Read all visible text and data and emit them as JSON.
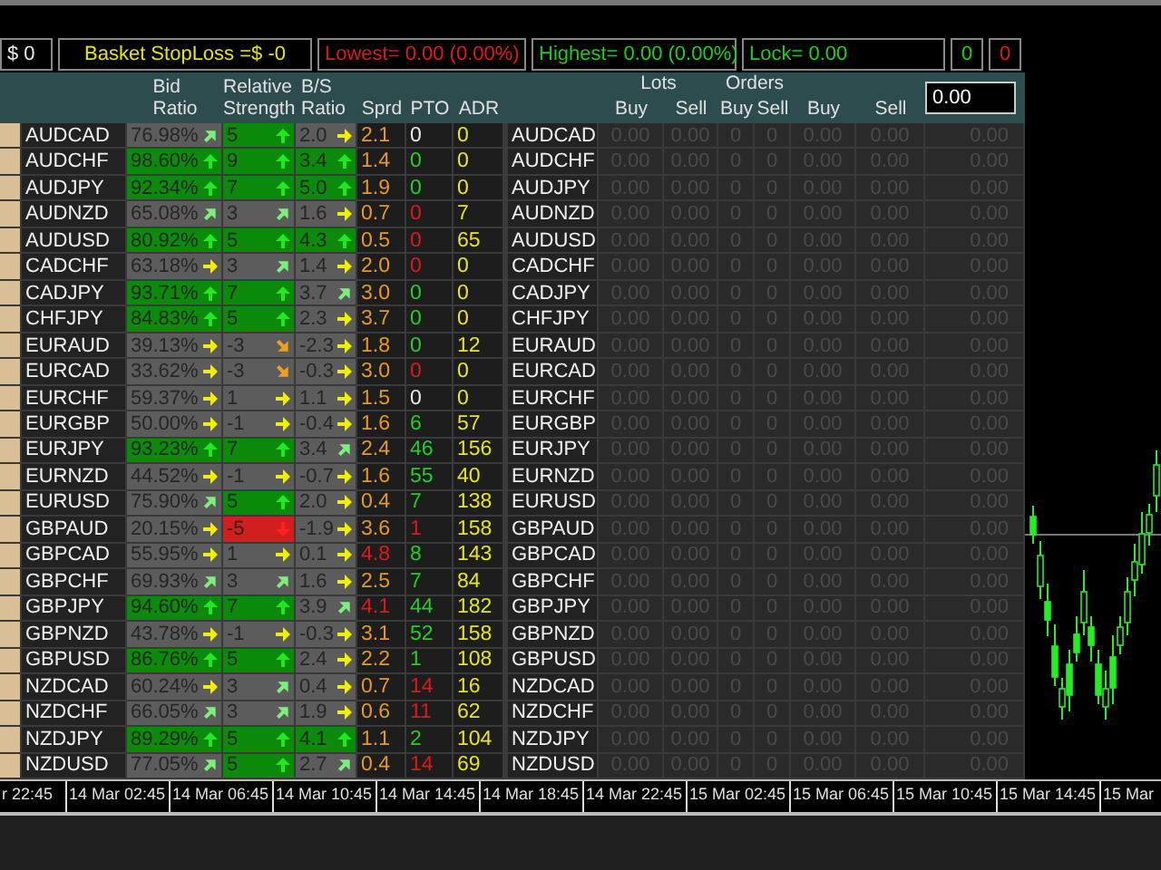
{
  "info_bar": [
    {
      "text": "$ 0",
      "color": "#e8e8e8"
    },
    {
      "text": "Basket StopLoss =$ -0",
      "color": "#e6e600"
    },
    {
      "text": "Lowest= 0.00 (0.00%)",
      "color": "#e01818"
    },
    {
      "text": "Highest= 0.00 (0.00%)",
      "color": "#18d018"
    },
    {
      "text": "Lock= 0.00",
      "color": "#18d018"
    },
    {
      "text": "0",
      "color": "#18d018"
    },
    {
      "text": "0",
      "color": "#e01818"
    }
  ],
  "header": {
    "bid_ratio": "Bid Ratio",
    "relative_strength": "Relative Strength",
    "bs_ratio": "B/S Ratio",
    "sprd": "Sprd",
    "pto": "PTO",
    "adr": "ADR",
    "lots": "Lots",
    "lots_buy": "Buy",
    "lots_sell": "Sell",
    "orders": "Orders",
    "orders_buy": "Buy",
    "orders_sell": "Sell",
    "profit_buy": "Buy",
    "profit_sell": "Sell",
    "total_field": "0.00"
  },
  "rows": [
    {
      "symbol": "AUDCAD",
      "bid": {
        "text": "76.98%",
        "kind": "up-right",
        "color": "#5c5c5c"
      },
      "rs": {
        "text": "5",
        "kind": "up",
        "color": "#0c8a0c"
      },
      "bs": {
        "text": "2.0",
        "kind": "right",
        "color": "#5c5c5c"
      },
      "sprd": {
        "text": "2.1",
        "color": "#e89a20"
      },
      "pto": {
        "text": "0",
        "color": "#e8e8e8"
      },
      "adr": "0",
      "symbol_2": "AUDCAD",
      "positions": [
        "0.00",
        "0.00",
        "0",
        "0",
        "0.00",
        "0.00",
        "0.00"
      ]
    },
    {
      "symbol": "AUDCHF",
      "bid": {
        "text": "98.60%",
        "kind": "up",
        "color": "#0c8a0c"
      },
      "rs": {
        "text": "9",
        "kind": "up",
        "color": "#0c8a0c"
      },
      "bs": {
        "text": "3.4",
        "kind": "up",
        "color": "#0c8a0c"
      },
      "sprd": {
        "text": "1.4",
        "color": "#e89a20"
      },
      "pto": {
        "text": "0",
        "color": "#22d022"
      },
      "adr": "0",
      "symbol_2": "AUDCHF",
      "positions": [
        "0.00",
        "0.00",
        "0",
        "0",
        "0.00",
        "0.00",
        "0.00"
      ]
    },
    {
      "symbol": "AUDJPY",
      "bid": {
        "text": "92.34%",
        "kind": "up",
        "color": "#0c8a0c"
      },
      "rs": {
        "text": "7",
        "kind": "up",
        "color": "#0c8a0c"
      },
      "bs": {
        "text": "5.0",
        "kind": "up",
        "color": "#0c8a0c"
      },
      "sprd": {
        "text": "1.9",
        "color": "#e89a20"
      },
      "pto": {
        "text": "0",
        "color": "#22d022"
      },
      "adr": "0",
      "symbol_2": "AUDJPY",
      "positions": [
        "0.00",
        "0.00",
        "0",
        "0",
        "0.00",
        "0.00",
        "0.00"
      ]
    },
    {
      "symbol": "AUDNZD",
      "bid": {
        "text": "65.08%",
        "kind": "up-right",
        "color": "#5c5c5c"
      },
      "rs": {
        "text": "3",
        "kind": "up-right",
        "color": "#5c5c5c"
      },
      "bs": {
        "text": "1.6",
        "kind": "right",
        "color": "#5c5c5c"
      },
      "sprd": {
        "text": "0.7",
        "color": "#e89a20"
      },
      "pto": {
        "text": "0",
        "color": "#e01818"
      },
      "adr": "7",
      "symbol_2": "AUDNZD",
      "positions": [
        "0.00",
        "0.00",
        "0",
        "0",
        "0.00",
        "0.00",
        "0.00"
      ]
    },
    {
      "symbol": "AUDUSD",
      "bid": {
        "text": "80.92%",
        "kind": "up",
        "color": "#0c8a0c"
      },
      "rs": {
        "text": "5",
        "kind": "up",
        "color": "#0c8a0c"
      },
      "bs": {
        "text": "4.3",
        "kind": "up",
        "color": "#0c8a0c"
      },
      "sprd": {
        "text": "0.5",
        "color": "#e89a20"
      },
      "pto": {
        "text": "0",
        "color": "#e01818"
      },
      "adr": "65",
      "symbol_2": "AUDUSD",
      "positions": [
        "0.00",
        "0.00",
        "0",
        "0",
        "0.00",
        "0.00",
        "0.00"
      ]
    },
    {
      "symbol": "CADCHF",
      "bid": {
        "text": "63.18%",
        "kind": "right",
        "color": "#5c5c5c"
      },
      "rs": {
        "text": "3",
        "kind": "up-right",
        "color": "#5c5c5c"
      },
      "bs": {
        "text": "1.4",
        "kind": "right",
        "color": "#5c5c5c"
      },
      "sprd": {
        "text": "2.0",
        "color": "#e89a20"
      },
      "pto": {
        "text": "0",
        "color": "#e01818"
      },
      "adr": "0",
      "symbol_2": "CADCHF",
      "positions": [
        "0.00",
        "0.00",
        "0",
        "0",
        "0.00",
        "0.00",
        "0.00"
      ]
    },
    {
      "symbol": "CADJPY",
      "bid": {
        "text": "93.71%",
        "kind": "up",
        "color": "#0c8a0c"
      },
      "rs": {
        "text": "7",
        "kind": "up",
        "color": "#0c8a0c"
      },
      "bs": {
        "text": "3.7",
        "kind": "up-right",
        "color": "#5c5c5c"
      },
      "sprd": {
        "text": "3.0",
        "color": "#e89a20"
      },
      "pto": {
        "text": "0",
        "color": "#22d022"
      },
      "adr": "0",
      "symbol_2": "CADJPY",
      "positions": [
        "0.00",
        "0.00",
        "0",
        "0",
        "0.00",
        "0.00",
        "0.00"
      ]
    },
    {
      "symbol": "CHFJPY",
      "bid": {
        "text": "84.83%",
        "kind": "up",
        "color": "#0c8a0c"
      },
      "rs": {
        "text": "5",
        "kind": "up",
        "color": "#0c8a0c"
      },
      "bs": {
        "text": "2.3",
        "kind": "right",
        "color": "#5c5c5c"
      },
      "sprd": {
        "text": "3.7",
        "color": "#e89a20"
      },
      "pto": {
        "text": "0",
        "color": "#22d022"
      },
      "adr": "0",
      "symbol_2": "CHFJPY",
      "positions": [
        "0.00",
        "0.00",
        "0",
        "0",
        "0.00",
        "0.00",
        "0.00"
      ]
    },
    {
      "symbol": "EURAUD",
      "bid": {
        "text": "39.13%",
        "kind": "right",
        "color": "#5c5c5c"
      },
      "rs": {
        "text": "-3",
        "kind": "down-right",
        "color": "#5c5c5c"
      },
      "bs": {
        "text": "-2.3",
        "kind": "right",
        "color": "#5c5c5c"
      },
      "sprd": {
        "text": "1.8",
        "color": "#e89a20"
      },
      "pto": {
        "text": "0",
        "color": "#22d022"
      },
      "adr": "12",
      "symbol_2": "EURAUD",
      "positions": [
        "0.00",
        "0.00",
        "0",
        "0",
        "0.00",
        "0.00",
        "0.00"
      ]
    },
    {
      "symbol": "EURCAD",
      "bid": {
        "text": "33.62%",
        "kind": "right",
        "color": "#5c5c5c"
      },
      "rs": {
        "text": "-3",
        "kind": "down-right",
        "color": "#5c5c5c"
      },
      "bs": {
        "text": "-0.3",
        "kind": "right",
        "color": "#5c5c5c"
      },
      "sprd": {
        "text": "3.0",
        "color": "#e89a20"
      },
      "pto": {
        "text": "0",
        "color": "#e01818"
      },
      "adr": "0",
      "symbol_2": "EURCAD",
      "positions": [
        "0.00",
        "0.00",
        "0",
        "0",
        "0.00",
        "0.00",
        "0.00"
      ]
    },
    {
      "symbol": "EURCHF",
      "bid": {
        "text": "59.37%",
        "kind": "right",
        "color": "#5c5c5c"
      },
      "rs": {
        "text": "1",
        "kind": "right",
        "color": "#5c5c5c"
      },
      "bs": {
        "text": "1.1",
        "kind": "right",
        "color": "#5c5c5c"
      },
      "sprd": {
        "text": "1.5",
        "color": "#e89a20"
      },
      "pto": {
        "text": "0",
        "color": "#e8e8e8"
      },
      "adr": "0",
      "symbol_2": "EURCHF",
      "positions": [
        "0.00",
        "0.00",
        "0",
        "0",
        "0.00",
        "0.00",
        "0.00"
      ]
    },
    {
      "symbol": "EURGBP",
      "bid": {
        "text": "50.00%",
        "kind": "right",
        "color": "#5c5c5c"
      },
      "rs": {
        "text": "-1",
        "kind": "right",
        "color": "#5c5c5c"
      },
      "bs": {
        "text": "-0.4",
        "kind": "right",
        "color": "#5c5c5c"
      },
      "sprd": {
        "text": "1.6",
        "color": "#e89a20"
      },
      "pto": {
        "text": "6",
        "color": "#22d022"
      },
      "adr": "57",
      "symbol_2": "EURGBP",
      "positions": [
        "0.00",
        "0.00",
        "0",
        "0",
        "0.00",
        "0.00",
        "0.00"
      ]
    },
    {
      "symbol": "EURJPY",
      "bid": {
        "text": "93.23%",
        "kind": "up",
        "color": "#0c8a0c"
      },
      "rs": {
        "text": "7",
        "kind": "up",
        "color": "#0c8a0c"
      },
      "bs": {
        "text": "3.4",
        "kind": "up-right",
        "color": "#5c5c5c"
      },
      "sprd": {
        "text": "2.4",
        "color": "#e89a20"
      },
      "pto": {
        "text": "46",
        "color": "#22d022"
      },
      "adr": "156",
      "symbol_2": "EURJPY",
      "positions": [
        "0.00",
        "0.00",
        "0",
        "0",
        "0.00",
        "0.00",
        "0.00"
      ]
    },
    {
      "symbol": "EURNZD",
      "bid": {
        "text": "44.52%",
        "kind": "right",
        "color": "#5c5c5c"
      },
      "rs": {
        "text": "-1",
        "kind": "right",
        "color": "#5c5c5c"
      },
      "bs": {
        "text": "-0.7",
        "kind": "right",
        "color": "#5c5c5c"
      },
      "sprd": {
        "text": "1.6",
        "color": "#e89a20"
      },
      "pto": {
        "text": "55",
        "color": "#22d022"
      },
      "adr": "40",
      "symbol_2": "EURNZD",
      "positions": [
        "0.00",
        "0.00",
        "0",
        "0",
        "0.00",
        "0.00",
        "0.00"
      ]
    },
    {
      "symbol": "EURUSD",
      "bid": {
        "text": "75.90%",
        "kind": "up-right",
        "color": "#5c5c5c"
      },
      "rs": {
        "text": "5",
        "kind": "up",
        "color": "#0c8a0c"
      },
      "bs": {
        "text": "2.0",
        "kind": "right",
        "color": "#5c5c5c"
      },
      "sprd": {
        "text": "0.4",
        "color": "#e89a20"
      },
      "pto": {
        "text": "7",
        "color": "#22d022"
      },
      "adr": "138",
      "symbol_2": "EURUSD",
      "positions": [
        "0.00",
        "0.00",
        "0",
        "0",
        "0.00",
        "0.00",
        "0.00"
      ]
    },
    {
      "symbol": "GBPAUD",
      "bid": {
        "text": "20.15%",
        "kind": "right",
        "color": "#5c5c5c"
      },
      "rs": {
        "text": "-5",
        "kind": "down",
        "color": "#d21e1e"
      },
      "bs": {
        "text": "-1.9",
        "kind": "right",
        "color": "#5c5c5c"
      },
      "sprd": {
        "text": "3.6",
        "color": "#e89a20"
      },
      "pto": {
        "text": "1",
        "color": "#e01818"
      },
      "adr": "158",
      "symbol_2": "GBPAUD",
      "positions": [
        "0.00",
        "0.00",
        "0",
        "0",
        "0.00",
        "0.00",
        "0.00"
      ]
    },
    {
      "symbol": "GBPCAD",
      "bid": {
        "text": "55.95%",
        "kind": "right",
        "color": "#5c5c5c"
      },
      "rs": {
        "text": "1",
        "kind": "right",
        "color": "#5c5c5c"
      },
      "bs": {
        "text": "0.1",
        "kind": "right",
        "color": "#5c5c5c"
      },
      "sprd": {
        "text": "4.8",
        "color": "#e01818"
      },
      "pto": {
        "text": "8",
        "color": "#22d022"
      },
      "adr": "143",
      "symbol_2": "GBPCAD",
      "positions": [
        "0.00",
        "0.00",
        "0",
        "0",
        "0.00",
        "0.00",
        "0.00"
      ]
    },
    {
      "symbol": "GBPCHF",
      "bid": {
        "text": "69.93%",
        "kind": "up-right",
        "color": "#5c5c5c"
      },
      "rs": {
        "text": "3",
        "kind": "up-right",
        "color": "#5c5c5c"
      },
      "bs": {
        "text": "1.6",
        "kind": "right",
        "color": "#5c5c5c"
      },
      "sprd": {
        "text": "2.5",
        "color": "#e89a20"
      },
      "pto": {
        "text": "7",
        "color": "#22d022"
      },
      "adr": "84",
      "symbol_2": "GBPCHF",
      "positions": [
        "0.00",
        "0.00",
        "0",
        "0",
        "0.00",
        "0.00",
        "0.00"
      ]
    },
    {
      "symbol": "GBPJPY",
      "bid": {
        "text": "94.60%",
        "kind": "up",
        "color": "#0c8a0c"
      },
      "rs": {
        "text": "7",
        "kind": "up",
        "color": "#0c8a0c"
      },
      "bs": {
        "text": "3.9",
        "kind": "up-right",
        "color": "#5c5c5c"
      },
      "sprd": {
        "text": "4.1",
        "color": "#e01818"
      },
      "pto": {
        "text": "44",
        "color": "#22d022"
      },
      "adr": "182",
      "symbol_2": "GBPJPY",
      "positions": [
        "0.00",
        "0.00",
        "0",
        "0",
        "0.00",
        "0.00",
        "0.00"
      ]
    },
    {
      "symbol": "GBPNZD",
      "bid": {
        "text": "43.78%",
        "kind": "right",
        "color": "#5c5c5c"
      },
      "rs": {
        "text": "-1",
        "kind": "right",
        "color": "#5c5c5c"
      },
      "bs": {
        "text": "-0.3",
        "kind": "right",
        "color": "#5c5c5c"
      },
      "sprd": {
        "text": "3.1",
        "color": "#e89a20"
      },
      "pto": {
        "text": "52",
        "color": "#22d022"
      },
      "adr": "158",
      "symbol_2": "GBPNZD",
      "positions": [
        "0.00",
        "0.00",
        "0",
        "0",
        "0.00",
        "0.00",
        "0.00"
      ]
    },
    {
      "symbol": "GBPUSD",
      "bid": {
        "text": "86.76%",
        "kind": "up",
        "color": "#0c8a0c"
      },
      "rs": {
        "text": "5",
        "kind": "up",
        "color": "#0c8a0c"
      },
      "bs": {
        "text": "2.4",
        "kind": "right",
        "color": "#5c5c5c"
      },
      "sprd": {
        "text": "2.2",
        "color": "#e89a20"
      },
      "pto": {
        "text": "1",
        "color": "#22d022"
      },
      "adr": "108",
      "symbol_2": "GBPUSD",
      "positions": [
        "0.00",
        "0.00",
        "0",
        "0",
        "0.00",
        "0.00",
        "0.00"
      ]
    },
    {
      "symbol": "NZDCAD",
      "bid": {
        "text": "60.24%",
        "kind": "right",
        "color": "#5c5c5c"
      },
      "rs": {
        "text": "3",
        "kind": "up-right",
        "color": "#5c5c5c"
      },
      "bs": {
        "text": "0.4",
        "kind": "right",
        "color": "#5c5c5c"
      },
      "sprd": {
        "text": "0.7",
        "color": "#e89a20"
      },
      "pto": {
        "text": "14",
        "color": "#e01818"
      },
      "adr": "16",
      "symbol_2": "NZDCAD",
      "positions": [
        "0.00",
        "0.00",
        "0",
        "0",
        "0.00",
        "0.00",
        "0.00"
      ]
    },
    {
      "symbol": "NZDCHF",
      "bid": {
        "text": "66.05%",
        "kind": "up-right",
        "color": "#5c5c5c"
      },
      "rs": {
        "text": "3",
        "kind": "up-right",
        "color": "#5c5c5c"
      },
      "bs": {
        "text": "1.9",
        "kind": "right",
        "color": "#5c5c5c"
      },
      "sprd": {
        "text": "0.6",
        "color": "#e89a20"
      },
      "pto": {
        "text": "11",
        "color": "#e01818"
      },
      "adr": "62",
      "symbol_2": "NZDCHF",
      "positions": [
        "0.00",
        "0.00",
        "0",
        "0",
        "0.00",
        "0.00",
        "0.00"
      ]
    },
    {
      "symbol": "NZDJPY",
      "bid": {
        "text": "89.29%",
        "kind": "up",
        "color": "#0c8a0c"
      },
      "rs": {
        "text": "5",
        "kind": "up",
        "color": "#0c8a0c"
      },
      "bs": {
        "text": "4.1",
        "kind": "up",
        "color": "#0c8a0c"
      },
      "sprd": {
        "text": "1.1",
        "color": "#e89a20"
      },
      "pto": {
        "text": "2",
        "color": "#22d022"
      },
      "adr": "104",
      "symbol_2": "NZDJPY",
      "positions": [
        "0.00",
        "0.00",
        "0",
        "0",
        "0.00",
        "0.00",
        "0.00"
      ]
    },
    {
      "symbol": "NZDUSD",
      "bid": {
        "text": "77.05%",
        "kind": "up-right",
        "color": "#5c5c5c"
      },
      "rs": {
        "text": "5",
        "kind": "up",
        "color": "#0c8a0c"
      },
      "bs": {
        "text": "2.7",
        "kind": "up-right",
        "color": "#5c5c5c"
      },
      "sprd": {
        "text": "0.4",
        "color": "#e89a20"
      },
      "pto": {
        "text": "14",
        "color": "#e01818"
      },
      "adr": "69",
      "symbol_2": "NZDUSD",
      "positions": [
        "0.00",
        "0.00",
        "0",
        "0",
        "0.00",
        "0.00",
        "0.00"
      ]
    }
  ],
  "time_axis": [
    "r 22:45",
    "14 Mar 02:45",
    "14 Mar 06:45",
    "14 Mar 10:45",
    "14 Mar 14:45",
    "14 Mar 18:45",
    "14 Mar 22:45",
    "15 Mar 02:45",
    "15 Mar 06:45",
    "15 Mar 10:45",
    "15 Mar 14:45",
    "15 Mar"
  ]
}
